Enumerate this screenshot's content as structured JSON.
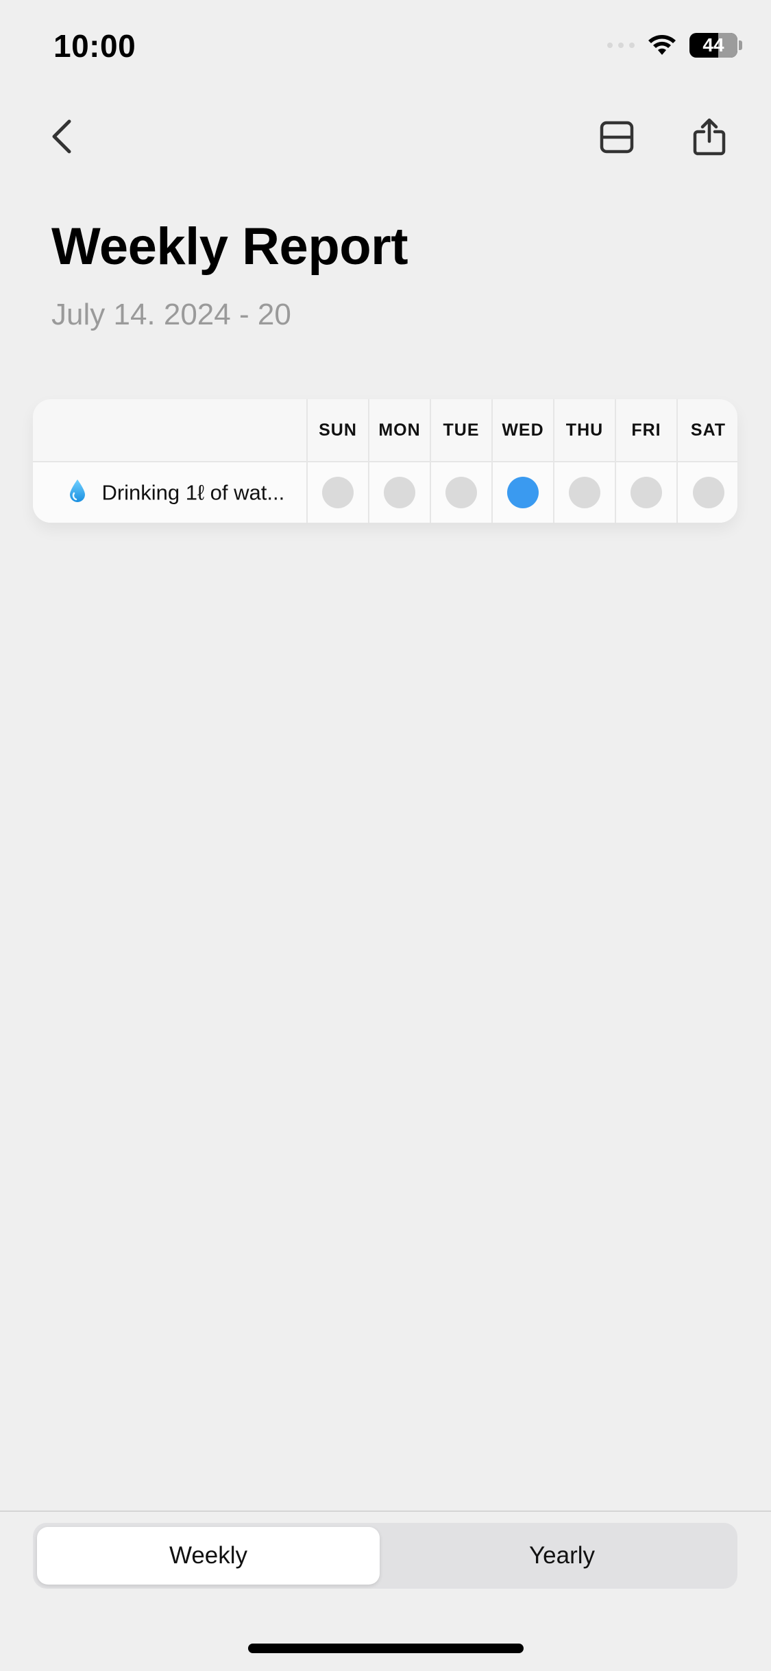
{
  "status_bar": {
    "time": "10:00",
    "battery": "44",
    "icons": [
      "wifi-icon",
      "battery-icon"
    ]
  },
  "nav": {
    "icons": {
      "back": "chevron-left-icon",
      "layout": "split-rectangle-icon",
      "share": "share-icon"
    }
  },
  "header": {
    "title": "Weekly Report",
    "date_range": "July 14. 2024 - 20"
  },
  "report": {
    "days": [
      "SUN",
      "MON",
      "TUE",
      "WED",
      "THU",
      "FRI",
      "SAT"
    ],
    "habits": [
      {
        "emoji": "water-drop-icon",
        "name": "Drinking 1ℓ of wat...",
        "completed": [
          false,
          false,
          false,
          true,
          false,
          false,
          false
        ]
      }
    ],
    "colors": {
      "done": "#3a9af0",
      "not_done": "#dadada"
    }
  },
  "segmented": {
    "options": [
      "Weekly",
      "Yearly"
    ],
    "selected": "Weekly"
  }
}
